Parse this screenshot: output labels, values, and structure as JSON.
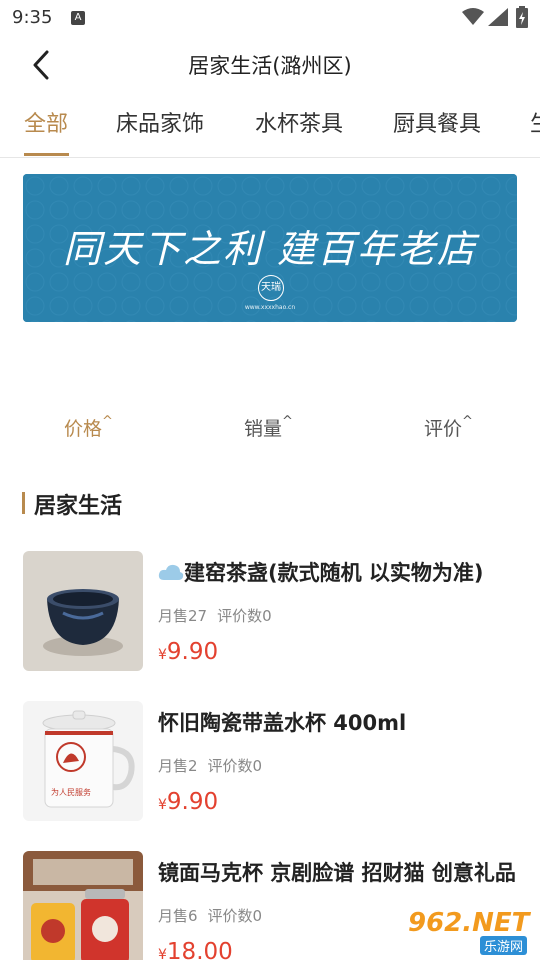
{
  "status_bar": {
    "time": "9:35",
    "notif": "A"
  },
  "nav": {
    "title": "居家生活(潞州区)"
  },
  "tabs": [
    {
      "label": "全部"
    },
    {
      "label": "床品家饰"
    },
    {
      "label": "水杯茶具"
    },
    {
      "label": "厨具餐具"
    },
    {
      "label": "生"
    }
  ],
  "banner": {
    "text": "同天下之利  建百年老店",
    "seal": "天瑞",
    "url": "www.xxxxhao.cn"
  },
  "sort": [
    {
      "label": "价格",
      "caret": "^"
    },
    {
      "label": "销量",
      "caret": "^"
    },
    {
      "label": "评价",
      "caret": "^"
    }
  ],
  "section": {
    "title": "居家生活"
  },
  "products": [
    {
      "name": "建窑茶盏(款式随机  以实物为准)",
      "sales": "月售27",
      "reviews": "评价数0",
      "price_symbol": "¥",
      "price": "9.90",
      "icon": "cloud-icon"
    },
    {
      "name": "怀旧陶瓷带盖水杯  400ml",
      "sales": "月售2",
      "reviews": "评价数0",
      "price_symbol": "¥",
      "price": "9.90",
      "mug_text": "为人民服务"
    },
    {
      "name": "镜面马克杯 京剧脸谱 招财猫 创意礼品",
      "sales": "月售6",
      "reviews": "评价数0",
      "price_symbol": "¥",
      "price": "18.00"
    }
  ],
  "watermark": {
    "top": "962.NET",
    "bottom": "乐游网"
  },
  "colors": {
    "accent": "#b88a4e",
    "price": "#e3412f",
    "banner": "#2a82ad"
  }
}
